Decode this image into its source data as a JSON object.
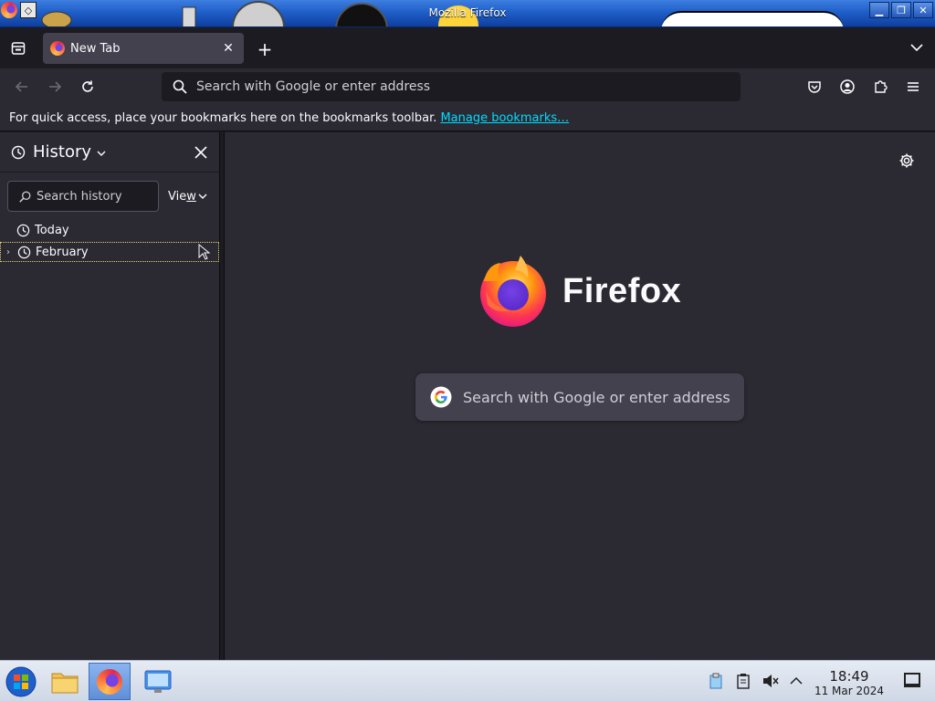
{
  "window": {
    "title": "Mozilla Firefox",
    "buttons": {
      "minimize": "▁",
      "maximize": "❐",
      "close": "✕"
    }
  },
  "tabs": [
    {
      "label": "New Tab",
      "close": "✕"
    }
  ],
  "toolbar": {
    "new_tab_label": "+",
    "url_placeholder": "Search with Google or enter address"
  },
  "bookmarks_bar": {
    "text": "For quick access, place your bookmarks here on the bookmarks toolbar.",
    "link": "Manage bookmarks…"
  },
  "sidebar": {
    "title": "History",
    "search_placeholder": "Search history",
    "view_label_prefix": "Vie",
    "view_label_underlined": "w",
    "items": [
      {
        "label": "Today",
        "expandable": false,
        "focused": false
      },
      {
        "label": "February",
        "expandable": true,
        "focused": true
      }
    ]
  },
  "content": {
    "brand_name": "Firefox",
    "search_placeholder": "Search with Google or enter address"
  },
  "taskbar": {
    "time": "18:49",
    "date": "11 Mar 2024"
  },
  "colors": {
    "accent_link": "#00ddff",
    "sidebar_bg": "#2b2a33",
    "content_bg": "#2b2a33",
    "tab_active": "#42414d"
  }
}
